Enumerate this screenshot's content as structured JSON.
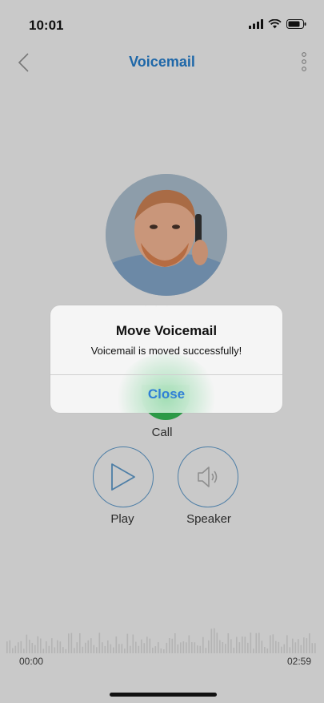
{
  "status_bar": {
    "time": "10:01"
  },
  "nav": {
    "title": "Voicemail",
    "back_icon": "chevron-left-icon",
    "more_icon": "more-vertical-icon"
  },
  "controls": {
    "call_label": "Call",
    "play_label": "Play",
    "speaker_label": "Speaker"
  },
  "playback": {
    "start_time": "00:00",
    "end_time": "02:59"
  },
  "dialog": {
    "title": "Move Voicemail",
    "message": "Voicemail is moved successfully!",
    "close_label": "Close"
  },
  "colors": {
    "accent": "#1e67a8",
    "dialog_button": "#2f7fd6",
    "call_green": "#2c9a47"
  }
}
